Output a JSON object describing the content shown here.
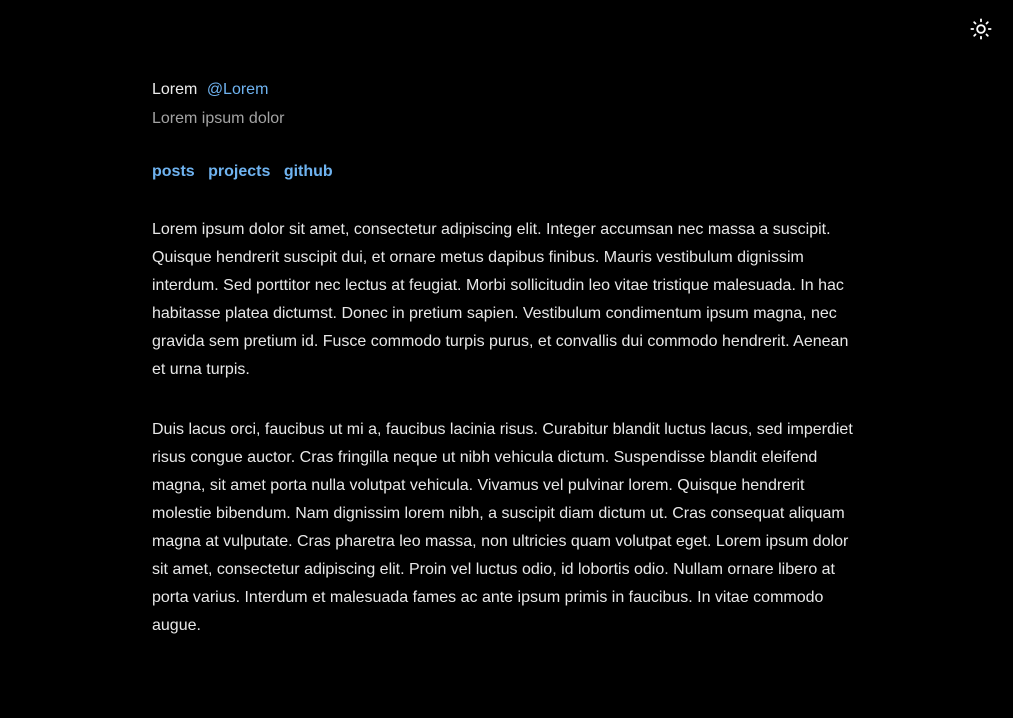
{
  "theme_toggle": {
    "icon": "sun-icon"
  },
  "profile": {
    "name": "Lorem",
    "handle": "@Lorem",
    "bio": "Lorem ipsum dolor"
  },
  "nav": {
    "items": [
      {
        "label": "posts"
      },
      {
        "label": "projects"
      },
      {
        "label": "github"
      }
    ]
  },
  "content": {
    "paragraphs": [
      "Lorem ipsum dolor sit amet, consectetur adipiscing elit. Integer accumsan nec massa a suscipit. Quisque hendrerit suscipit dui, et ornare metus dapibus finibus. Mauris vestibulum dignissim interdum. Sed porttitor nec lectus at feugiat. Morbi sollicitudin leo vitae tristique malesuada. In hac habitasse platea dictumst. Donec in pretium sapien. Vestibulum condimentum ipsum magna, nec gravida sem pretium id. Fusce commodo turpis purus, et convallis dui commodo hendrerit. Aenean et urna turpis.",
      "Duis lacus orci, faucibus ut mi a, faucibus lacinia risus. Curabitur blandit luctus lacus, sed imperdiet risus congue auctor. Cras fringilla neque ut nibh vehicula dictum. Suspendisse blandit eleifend magna, sit amet porta nulla volutpat vehicula. Vivamus vel pulvinar lorem. Quisque hendrerit molestie bibendum. Nam dignissim lorem nibh, a suscipit diam dictum ut. Cras consequat aliquam magna at vulputate. Cras pharetra leo massa, non ultricies quam volutpat eget. Lorem ipsum dolor sit amet, consectetur adipiscing elit. Proin vel luctus odio, id lobortis odio. Nullam ornare libero at porta varius. Interdum et malesuada fames ac ante ipsum primis in faucibus. In vitae commodo augue."
    ]
  },
  "colors": {
    "background": "#000000",
    "text": "#e8e8e8",
    "muted": "#a3a3a3",
    "accent": "#6fb3f0"
  }
}
